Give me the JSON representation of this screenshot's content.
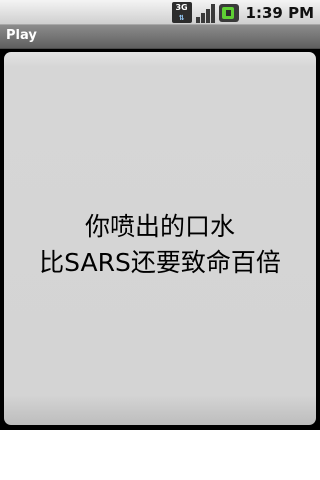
{
  "status_bar": {
    "network_type": "3G",
    "time": "1:39 PM",
    "colors": {
      "battery": "#5fd034"
    }
  },
  "title_bar": {
    "title": "Play"
  },
  "message": {
    "lines": [
      "你喷出的口水",
      "比SARS还要致命百倍"
    ]
  }
}
